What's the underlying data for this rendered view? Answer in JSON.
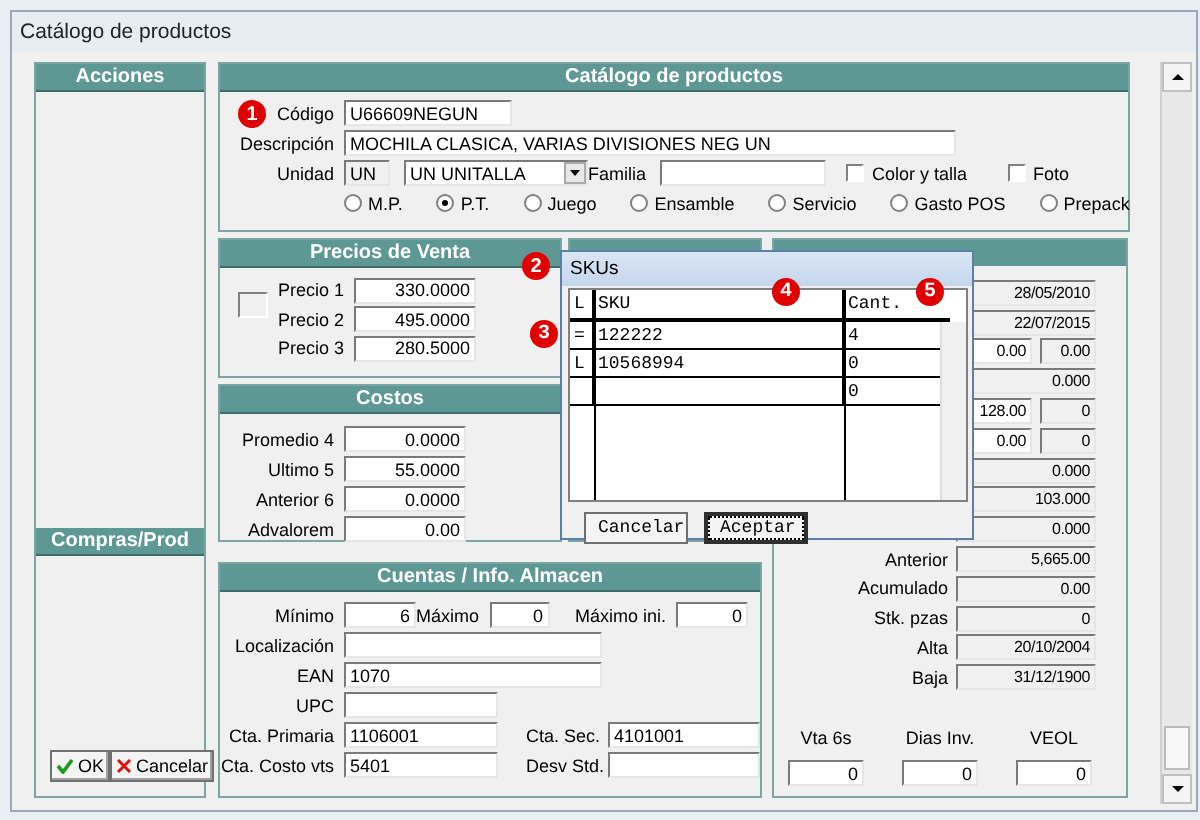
{
  "window": {
    "title": "Catálogo de productos"
  },
  "acciones": {
    "title": "Acciones"
  },
  "compras": {
    "title": "Compras/Prod",
    "buttons": [
      {
        "label": "OK"
      },
      {
        "label": "Cancelar"
      }
    ]
  },
  "catalogo": {
    "title": "Catálogo de productos",
    "marker": "1",
    "codigo": {
      "label": "Código",
      "value": "U66609NEGUN"
    },
    "descripcion": {
      "label": "Descripción",
      "value": "MOCHILA CLASICA, VARIAS DIVISIONES NEG UN"
    },
    "unidad": {
      "label": "Unidad",
      "code": "UN",
      "value": "UN  UNITALLA"
    },
    "familia": {
      "label": "Familia"
    },
    "checkboxes": [
      {
        "label": "Color y talla",
        "checked": false
      },
      {
        "label": "Foto",
        "checked": false
      }
    ],
    "types": [
      {
        "label": "M.P.",
        "selected": false
      },
      {
        "label": "P.T.",
        "selected": true
      },
      {
        "label": "Juego",
        "selected": false
      },
      {
        "label": "Ensamble",
        "selected": false
      },
      {
        "label": "Servicio",
        "selected": false
      },
      {
        "label": "Gasto POS",
        "selected": false
      },
      {
        "label": "Prepack",
        "selected": false
      }
    ]
  },
  "precios": {
    "title": "Precios de Venta",
    "checked": false,
    "fields": [
      {
        "label": "Precio 1",
        "value": "330.0000"
      },
      {
        "label": "Precio 2",
        "value": "495.0000"
      },
      {
        "label": "Precio 3",
        "value": "280.5000"
      }
    ]
  },
  "costos": {
    "title": "Costos",
    "fields": [
      {
        "label": "Promedio 4",
        "value": "0.0000"
      },
      {
        "label": "Ultimo 5",
        "value": "55.0000"
      },
      {
        "label": "Anterior 6",
        "value": "0.0000"
      },
      {
        "label": "Advalorem",
        "value": "0.00"
      }
    ]
  },
  "cuentas": {
    "title": "Cuentas / Info. Almacen",
    "minimo": {
      "label": "Mínimo",
      "value": "6"
    },
    "maximo": {
      "label": "Máximo",
      "value": "0"
    },
    "maximo_ini": {
      "label": "Máximo ini.",
      "value": "0"
    },
    "localizacion": {
      "label": "Localización"
    },
    "ean": {
      "label": "EAN",
      "value": "1070"
    },
    "upc": {
      "label": "UPC"
    },
    "cta_primaria": {
      "label": "Cta. Primaria",
      "value": "1106001"
    },
    "cta_sec": {
      "label": "Cta. Sec.",
      "value": "4101001"
    },
    "cta_costo": {
      "label": "Cta. Costo vts",
      "value": "5401"
    },
    "desv_std": {
      "label": "Desv Std."
    }
  },
  "resumen": {
    "rows": [
      {
        "fields": [
          {
            "value": "28/05/2010",
            "disabled": true
          }
        ]
      },
      {
        "fields": [
          {
            "value": "22/07/2015",
            "disabled": true
          }
        ]
      },
      {
        "fields": [
          {
            "value": "0.00",
            "disabled": false
          },
          {
            "value": "0.00",
            "disabled": true
          }
        ]
      },
      {
        "fields": [
          {
            "value": "0.000",
            "disabled": true
          }
        ]
      },
      {
        "fields": [
          {
            "value": "128.00",
            "disabled": false
          },
          {
            "value": "0",
            "disabled": true
          }
        ]
      },
      {
        "fields": [
          {
            "value": "0.00",
            "disabled": false
          },
          {
            "value": "0",
            "disabled": true
          }
        ]
      },
      {
        "fields": [
          {
            "value": "0.000",
            "disabled": true
          }
        ]
      },
      {
        "fields": [
          {
            "value": "103.000",
            "disabled": true
          }
        ]
      },
      {
        "fields": [
          {
            "value": "0.000",
            "disabled": true
          }
        ]
      },
      {
        "label": "Anterior",
        "fields": [
          {
            "value": "5,665.00",
            "disabled": true
          }
        ]
      },
      {
        "label": "Acumulado",
        "fields": [
          {
            "value": "0.00",
            "disabled": true
          }
        ]
      },
      {
        "label": "Stk. pzas",
        "fields": [
          {
            "value": "0",
            "disabled": true
          }
        ]
      },
      {
        "label": "Alta",
        "fields": [
          {
            "value": "20/10/2004",
            "disabled": true
          }
        ]
      },
      {
        "label": "Baja",
        "fields": [
          {
            "value": "31/12/1900",
            "disabled": true
          }
        ]
      }
    ],
    "bottom": [
      {
        "label": "Vta 6s",
        "value": "0"
      },
      {
        "label": "Dias Inv.",
        "value": "0"
      },
      {
        "label": "VEOL",
        "value": "0"
      }
    ]
  },
  "skus_dialog": {
    "title": "SKUs",
    "marker": "2",
    "columns": [
      {
        "label": "L"
      },
      {
        "label": "SKU",
        "marker": "4"
      },
      {
        "label": "Cant.",
        "marker": "5"
      }
    ],
    "rows": [
      {
        "l": "=",
        "sku": "122222",
        "cant": "4",
        "marker": "3"
      },
      {
        "l": "L",
        "sku": "10568994",
        "cant": "0"
      },
      {
        "cant": "0"
      }
    ],
    "buttons": [
      {
        "label": "Cancelar",
        "default": false
      },
      {
        "label": "Aceptar",
        "default": true
      }
    ]
  }
}
